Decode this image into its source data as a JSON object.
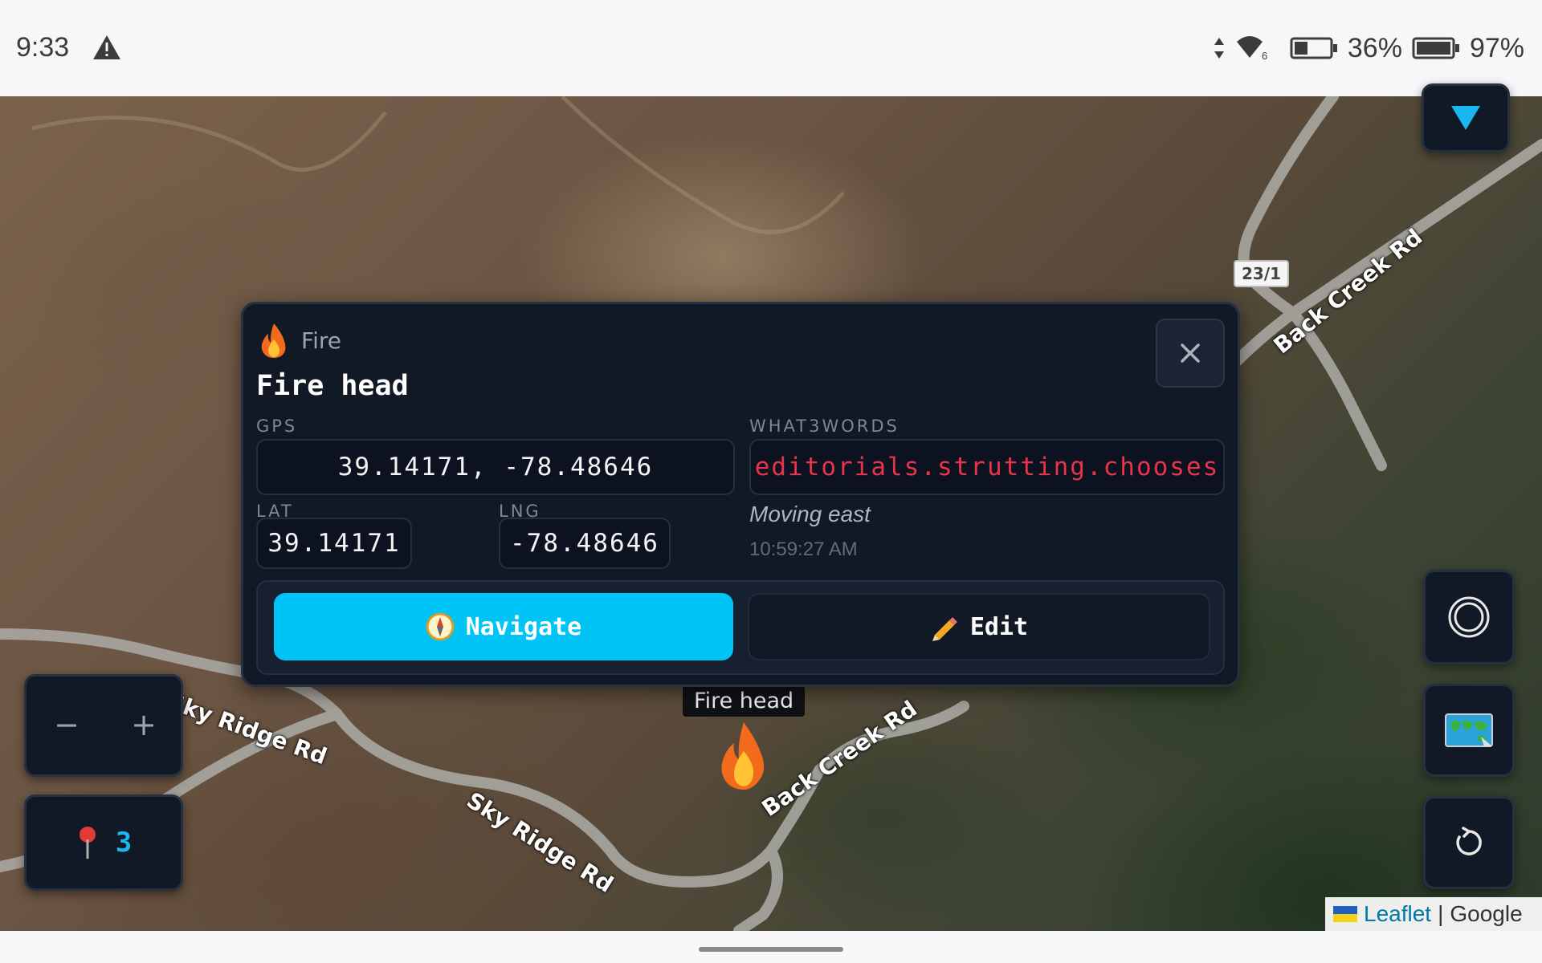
{
  "status_bar": {
    "time": "9:33",
    "warning_icon": "warning-triangle-icon",
    "battery_a_percent": "36%",
    "battery_b_percent": "97%"
  },
  "map": {
    "road_labels": [
      "Back Creek Rd",
      "Sky Ridge Rd",
      "Back Creek Rd",
      "Sky Ridge Rd"
    ],
    "route_shield": "23/1",
    "attribution": {
      "leaflet": "Leaflet",
      "separator": "|",
      "google": "Google"
    }
  },
  "marker": {
    "label": "Fire head",
    "icon": "fire-icon",
    "count": "3"
  },
  "popup": {
    "category": "Fire",
    "title": "Fire head",
    "gps_label": "GPS",
    "gps_value": "39.14171, -78.48646",
    "w3w_label": "WHAT3WORDS",
    "w3w_value": "editorials.strutting.chooses",
    "lat_label": "LAT",
    "lat_value": "39.14171",
    "lng_label": "LNG",
    "lng_value": "-78.48646",
    "status": "Moving east",
    "timestamp": "10:59:27 AM",
    "navigate_label": "Navigate",
    "edit_label": "Edit"
  },
  "controls": {
    "zoom_out": "−",
    "zoom_in": "+"
  },
  "colors": {
    "accent": "#00c4f5",
    "w3w_red": "#e8344b",
    "panel_bg": "#111826"
  }
}
